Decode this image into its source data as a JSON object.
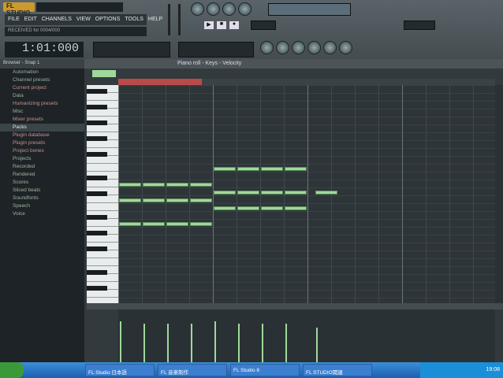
{
  "app": {
    "logo": "FL STUDIO"
  },
  "menu": [
    "FILE",
    "EDIT",
    "CHANNELS",
    "VIEW",
    "OPTIONS",
    "TOOLS",
    "HELP"
  ],
  "hint": "RECEIVED for 0004/000",
  "time": "1:01:000",
  "browser": {
    "title": "Browser - Snap 1",
    "items": [
      {
        "label": "Automation"
      },
      {
        "label": "Channel presets"
      },
      {
        "label": "Current project",
        "red": true
      },
      {
        "label": "Data"
      },
      {
        "label": "Humanizing presets",
        "red": true
      },
      {
        "label": "Misc"
      },
      {
        "label": "Mixer presets",
        "red": true
      },
      {
        "label": "Packs",
        "sel": true
      },
      {
        "label": "Plugin database",
        "red": true
      },
      {
        "label": "Plugin presets",
        "red": true
      },
      {
        "label": "Project bones",
        "red": true
      },
      {
        "label": "Projects"
      },
      {
        "label": "Recorded"
      },
      {
        "label": "Rendered"
      },
      {
        "label": "Scores"
      },
      {
        "label": "Sliced beats"
      },
      {
        "label": "Soundfonts"
      },
      {
        "label": "Speech"
      },
      {
        "label": "Voice"
      }
    ]
  },
  "pianoroll": {
    "title": "Piano roll - Keys - Velocity"
  },
  "notes": [
    {
      "start": 0,
      "len": 4,
      "row": 12
    },
    {
      "start": 0,
      "len": 4,
      "row": 14
    },
    {
      "start": 0,
      "len": 4,
      "row": 17
    },
    {
      "start": 4,
      "len": 4,
      "row": 10
    },
    {
      "start": 4,
      "len": 4,
      "row": 13
    },
    {
      "start": 4,
      "len": 4,
      "row": 15
    },
    {
      "start": 8.3,
      "len": 1,
      "row": 13
    }
  ],
  "velocity": [
    0.95,
    0.9,
    0.9,
    0.9,
    0.95,
    0.9,
    0.9,
    0.9,
    0.8
  ],
  "taskbar": {
    "items": [
      "FL Studio 日本語",
      "FL 音楽制作",
      "FL Studio 8",
      "FL STUDIO関連"
    ],
    "clock": "19:08"
  }
}
